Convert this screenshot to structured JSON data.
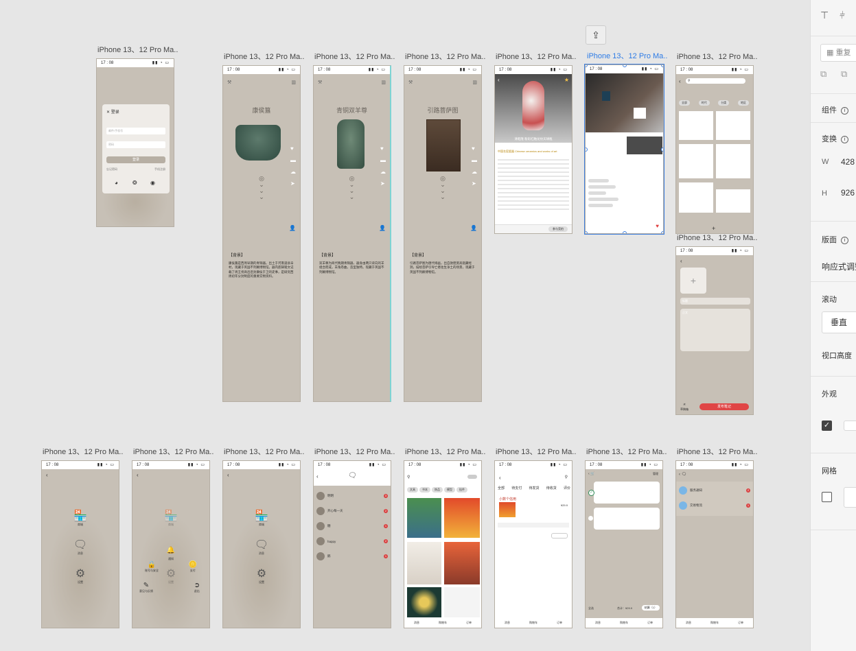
{
  "artboard_label": "iPhone 13、12 Pro Ma...",
  "status_time": "17 : 08",
  "share_icon": "share-icon",
  "login": {
    "title": "登录",
    "account_placeholder": "邮件/手机号",
    "password_placeholder": "密码",
    "login_button": "登录",
    "forgot": "忘记密码",
    "register": "手机注册"
  },
  "relics": [
    {
      "title": "康侯簋",
      "label": "【背景】"
    },
    {
      "title": "青铜双羊尊",
      "label": "【背景】"
    },
    {
      "title": "引路菩萨图",
      "label": "【背景】"
    }
  ],
  "relic_text_1": "康侯簋是西周早期的青铜器。出土于河南浚县辛村，现藏于英国不列颠博物馆。器内底铸铭文记载了周王伐商邑后封康侯于卫的史事，是研究西周初年分封制度的重要实物资料。",
  "relic_text_2": "双羊尊为商代晚期青铜器，器身由两只背向的羊组合而成，羊角卷曲，造型独特。现藏于英国不列颠博物馆。",
  "relic_text_3": "引路菩萨图为唐代绢画，出自敦煌莫高窟藏经洞，描绘菩萨引导亡者往生净土的场景，现藏于英国不列颠博物馆。",
  "auction": {
    "caption": "清乾隆 粉彩红釉龙纹天球瓶",
    "heading": "中国名窑瓷器 Chinese ceramics and works of art",
    "bottom_button": "参与竞拍"
  },
  "post": {
    "add_symbol": "+",
    "title_placeholder": "标题",
    "body_placeholder": "正文",
    "publish_button": "发布笔记",
    "draft": "草稿箱"
  },
  "search_tabs": [
    "全部",
    "时代",
    "分类",
    "地区"
  ],
  "menu": [
    {
      "icon": "store-icon",
      "label": "商城"
    },
    {
      "icon": "message-icon",
      "label": "消息"
    },
    {
      "icon": "gear-icon",
      "label": "设置"
    }
  ],
  "settings_menu": [
    {
      "label": "通知"
    },
    {
      "label": "账号与安全"
    },
    {
      "label": "支付"
    },
    {
      "label": "意见与反馈"
    },
    {
      "label": "退出"
    }
  ],
  "chats": [
    {
      "name": "明明",
      "badge": "3"
    },
    {
      "name": "开心每一天",
      "badge": "2"
    },
    {
      "name": "糖",
      "badge": "1"
    },
    {
      "name": "happy",
      "badge": "2"
    },
    {
      "name": "鹅",
      "badge": "1"
    }
  ],
  "shop_tabs": [
    "文具",
    "书本",
    "饰品",
    "模型",
    "挂件"
  ],
  "orders": {
    "tabs": [
      "全部",
      "待支付",
      "待发货",
      "待收货",
      "评价"
    ],
    "section": "小数个信用",
    "price": "¥29.9"
  },
  "cart": {
    "title": "购物车",
    "manage": "管理",
    "select_all": "全选",
    "total": "合计：¥29.9",
    "checkout": "结算（1）"
  },
  "notify": {
    "items": [
      "服务通知",
      "交易物流"
    ],
    "badges": [
      "2",
      "1"
    ]
  },
  "bottom_nav": [
    "消息",
    "购物车",
    "订单"
  ],
  "panel": {
    "search_placeholder": "重复",
    "component": "组件",
    "transform": "变换",
    "w_label": "W",
    "w_value": "428",
    "h_label": "H",
    "h_value": "926",
    "layout": "版面",
    "responsive": "响应式调整",
    "scroll": "滚动",
    "vertical": "垂直",
    "viewport": "视口高度",
    "appearance": "外观",
    "grid": "网格"
  }
}
